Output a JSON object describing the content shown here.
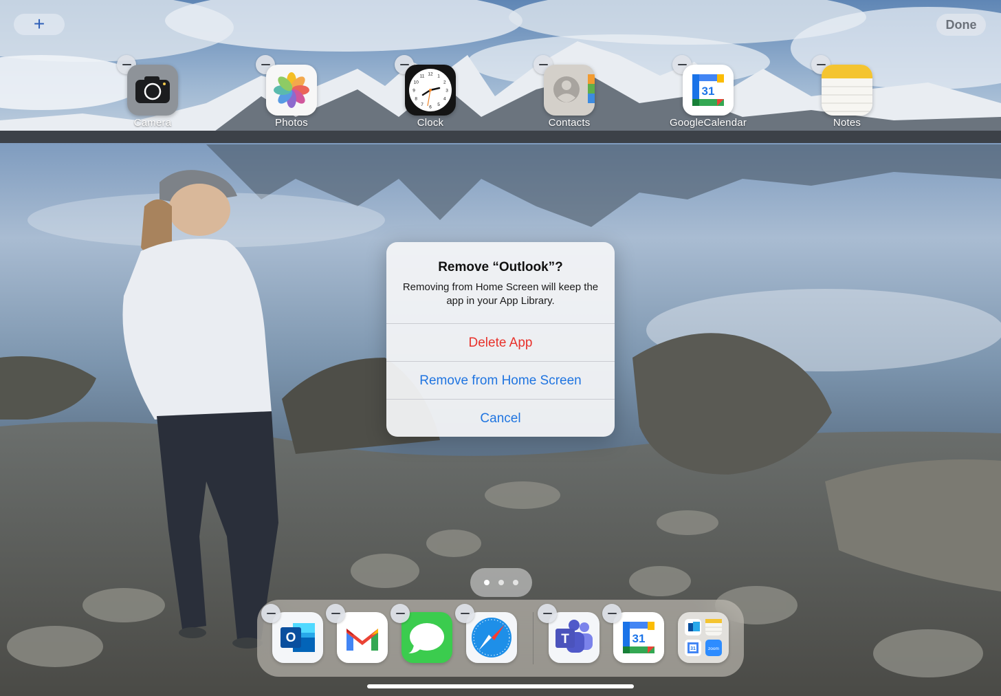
{
  "top_bar": {
    "add_label": "+",
    "done_label": "Done"
  },
  "home_apps": [
    {
      "label": "Camera",
      "icon": "camera-icon"
    },
    {
      "label": "Photos",
      "icon": "photos-icon"
    },
    {
      "label": "Clock",
      "icon": "clock-icon"
    },
    {
      "label": "Contacts",
      "icon": "contacts-icon"
    },
    {
      "label": "GoogleCalendar",
      "icon": "google-calendar-icon",
      "day": "31"
    },
    {
      "label": "Notes",
      "icon": "notes-icon"
    }
  ],
  "clock_face": {
    "numbers": [
      "12",
      "1",
      "2",
      "3",
      "4",
      "5",
      "6",
      "7",
      "8",
      "9",
      "10",
      "11"
    ]
  },
  "alert": {
    "title": "Remove “Outlook”?",
    "message": "Removing from Home Screen will keep the app in your App Library.",
    "buttons": {
      "delete": "Delete App",
      "remove": "Remove from Home Screen",
      "cancel": "Cancel"
    }
  },
  "page_indicator": {
    "pages": 3,
    "current": 1
  },
  "dock": [
    {
      "name": "Outlook",
      "icon": "outlook-icon",
      "letter": "O"
    },
    {
      "name": "Gmail",
      "icon": "gmail-icon"
    },
    {
      "name": "Messages",
      "icon": "messages-icon"
    },
    {
      "name": "Safari",
      "icon": "safari-icon"
    },
    {
      "name": "Teams",
      "icon": "teams-icon",
      "letter": "T"
    },
    {
      "name": "Google Calendar",
      "icon": "google-calendar-icon",
      "day": "31"
    },
    {
      "name": "App Library",
      "icon": "app-library-folder-icon",
      "mini_day": "31",
      "mini_zoom": "zoom"
    }
  ],
  "colors": {
    "accent_blue": "#1f74e0",
    "destructive_red": "#e8312b"
  }
}
